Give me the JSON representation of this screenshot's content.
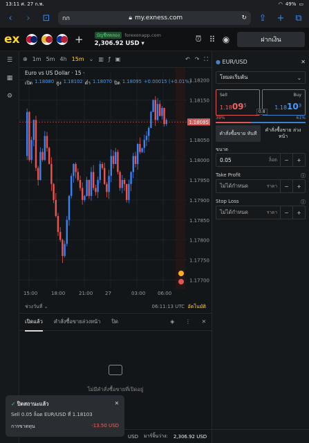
{
  "status_bar": {
    "time": "13:11",
    "date": "ศ. 27 ก.พ.",
    "battery": "49%"
  },
  "browser": {
    "tab_label": "กก",
    "url": "my.exness.com"
  },
  "app": {
    "logo": "ex",
    "account_type": "บัญชีทดลอง",
    "server": "forexonapp.com",
    "balance": "2,306.92 USD",
    "deposit_label": "ฝากเงิน"
  },
  "chart_toolbar": {
    "timeframes": [
      "1m",
      "5m",
      "4h",
      "15m"
    ],
    "selected": "15m"
  },
  "chart_info": {
    "title": "Euro vs US Dollar · 15 ·",
    "open_label": "เปิด",
    "open": "1.18080",
    "high_label": "สูง",
    "high": "1.18102",
    "low_label": "ต่ำ",
    "low": "1.18070",
    "close_label": "ปิด",
    "close": "1.18095",
    "change": "+0.00015 (+0.01%)"
  },
  "chart_data": {
    "type": "candlestick",
    "ylim": [
      1.1768,
      1.1822
    ],
    "y_ticks": [
      "1.18200",
      "1.18150",
      "1.18100",
      "1.18050",
      "1.18000",
      "1.17950",
      "1.17900",
      "1.17850",
      "1.17800",
      "1.17750",
      "1.17700"
    ],
    "x_ticks": [
      "15:00",
      "18:00",
      "21:00",
      "27",
      "03:00",
      "06:00"
    ],
    "current_price": "1.18095",
    "colors": {
      "up": "#3b82f6",
      "down": "#ef5350"
    }
  },
  "chart_bottom": {
    "period_label": "ช่วงวันที่",
    "clock": "06:11:13 UTC",
    "auto_label": "อัตโนมัติ"
  },
  "order_panel": {
    "symbol": "EUR/USD",
    "mode": "โหมดเริ่มต้น",
    "sell_label": "Sell",
    "sell_price_prefix": "1.18",
    "sell_price_big": "09",
    "sell_price_sup": "5",
    "buy_label": "Buy",
    "buy_price_prefix": "1.18",
    "buy_price_big": "10",
    "buy_price_sup": "3",
    "spread": "0.8",
    "sell_pct": "39%",
    "buy_pct": "61%",
    "market_order": "คำสั่งซื้อขาย ทันที",
    "pending_order": "คำสั่งซื้อขาย ล่วงหน้า",
    "volume_label": "ขนาด",
    "volume": "0.05",
    "volume_unit": "ล็อต",
    "tp_label": "Take Profit",
    "tp_value": "ไม่ได้กำหนด",
    "tp_unit": "ราคา",
    "sl_label": "Stop Loss",
    "sl_value": "ไม่ได้กำหนด",
    "sl_unit": "ราคา"
  },
  "bottom_tabs": {
    "open": "เปิดแล้ว",
    "pending": "คำสั่งซื้อขายล่วงหน้า",
    "closed": "ปิด"
  },
  "empty_text": "ไม่มีคำสั่งซื้อขายที่เปิดอยู่",
  "toast": {
    "title": "ปิดสถานะแล้ว",
    "body": "Sell 0.05 ล็อต EUR/USD ที่ 1.18103",
    "loss_label": "การขาดทุน",
    "loss_value": "-13.50 USD"
  },
  "footer": {
    "currency": "USD",
    "balance_label": "มาร์จิ้นว่าง:",
    "balance": "2,306.92 USD"
  }
}
